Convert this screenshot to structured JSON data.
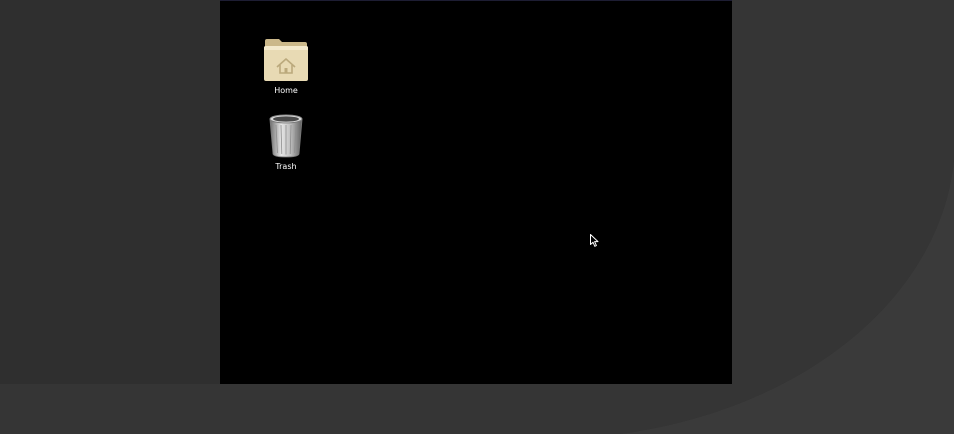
{
  "desktop": {
    "icons": [
      {
        "label": "Home",
        "icon": "home-folder-icon"
      },
      {
        "label": "Trash",
        "icon": "trash-bin-icon"
      }
    ]
  },
  "colors": {
    "backdrop_dark": "#2f2f2f",
    "backdrop_light": "#3a3a3a",
    "screen_background": "#000000",
    "folder": "#e8dab4",
    "label_text": "#ffffff"
  }
}
